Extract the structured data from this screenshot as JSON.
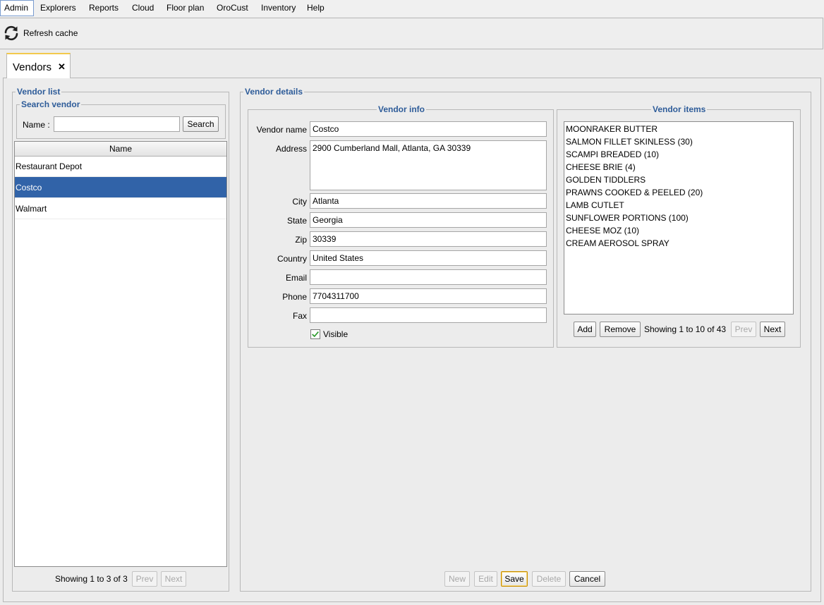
{
  "menu": [
    "Admin",
    "Explorers",
    "Reports",
    "Cloud",
    "Floor plan",
    "OroCust",
    "Inventory",
    "Help"
  ],
  "toolbar": {
    "refresh_label": "Refresh cache",
    "refresh_icon": "refresh-icon"
  },
  "tab": {
    "label": "Vendors",
    "close": "✕"
  },
  "vendor_list": {
    "title": "Vendor list",
    "search_title": "Search vendor",
    "name_label": "Name :",
    "name_value": "",
    "search_button": "Search",
    "column_header": "Name",
    "rows": [
      "Restaurant Depot",
      "Costco",
      "Walmart"
    ],
    "selected_row": "Costco",
    "showing": "Showing 1 to 3 of 3",
    "prev": "Prev",
    "next": "Next"
  },
  "vendor_details": {
    "title": "Vendor details",
    "info": {
      "title": "Vendor info",
      "vendor_name_label": "Vendor name",
      "vendor_name": "Costco",
      "address_label": "Address",
      "address": "2900 Cumberland Mall, Atlanta, GA 30339",
      "city_label": "City",
      "city": "Atlanta",
      "state_label": "State",
      "state": "Georgia",
      "zip_label": "Zip",
      "zip": "30339",
      "country_label": "Country",
      "country": "United States",
      "email_label": "Email",
      "email": "",
      "phone_label": "Phone",
      "phone": "7704311700",
      "fax_label": "Fax",
      "fax": "",
      "visible_label": "Visible",
      "visible_checked": true
    },
    "items": {
      "title": "Vendor items",
      "list": [
        "MOONRAKER BUTTER",
        "SALMON FILLET SKINLESS (30)",
        "SCAMPI BREADED (10)",
        "CHEESE BRIE (4)",
        "GOLDEN TIDDLERS",
        "PRAWNS COOKED & PEELED (20)",
        "LAMB CUTLET",
        "SUNFLOWER PORTIONS (100)",
        "CHEESE MOZ (10)",
        "CREAM AEROSOL SPRAY"
      ],
      "add": "Add",
      "remove": "Remove",
      "showing": "Showing 1 to 10 of 43",
      "prev": "Prev",
      "next": "Next"
    },
    "actions": {
      "new": "New",
      "edit": "Edit",
      "save": "Save",
      "delete": "Delete",
      "cancel": "Cancel"
    }
  },
  "colors": {
    "accent": "#2e5c99",
    "selection": "#3163a8",
    "tab_highlight": "#f2c94c",
    "check": "#2d9a2d"
  }
}
